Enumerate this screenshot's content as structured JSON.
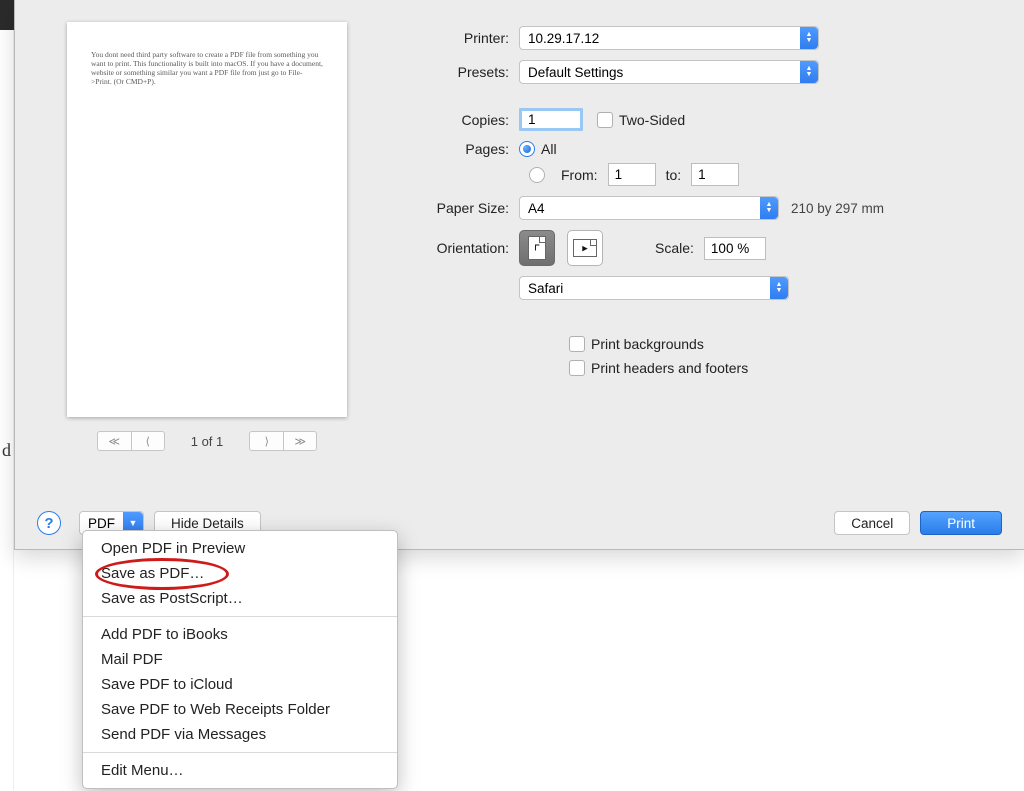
{
  "previewText": "You dont need third party software to create a PDF file from something you want to print. This functionality is built into macOS. If you have a document, website or something similar you want a PDF file from just go to File->Print. (Or CMD+P).",
  "pageNav": {
    "label": "1 of 1"
  },
  "form": {
    "printer": {
      "label": "Printer:",
      "value": "10.29.17.12"
    },
    "presets": {
      "label": "Presets:",
      "value": "Default Settings"
    },
    "copies": {
      "label": "Copies:",
      "value": "1",
      "twoSidedLabel": "Two-Sided"
    },
    "pages": {
      "label": "Pages:",
      "allLabel": "All",
      "fromLabel": "From:",
      "fromValue": "1",
      "toLabel": "to:",
      "toValue": "1"
    },
    "paperSize": {
      "label": "Paper Size:",
      "value": "A4",
      "dims": "210 by 297 mm"
    },
    "orientation": {
      "label": "Orientation:"
    },
    "scale": {
      "label": "Scale:",
      "value": "100 %"
    },
    "app": {
      "value": "Safari"
    },
    "printBackgrounds": "Print backgrounds",
    "printHeadersFooters": "Print headers and footers"
  },
  "footer": {
    "help": "?",
    "pdfLabel": "PDF",
    "hideDetails": "Hide Details",
    "cancel": "Cancel",
    "print": "Print"
  },
  "menu": {
    "openPreview": "Open PDF in Preview",
    "saveAsPdf": "Save as PDF…",
    "saveAsPostscript": "Save as PostScript…",
    "addToIbooks": "Add PDF to iBooks",
    "mailPdf": "Mail PDF",
    "saveToIcloud": "Save PDF to iCloud",
    "saveToWebReceipts": "Save PDF to Web Receipts Folder",
    "sendViaMessages": "Send PDF via Messages",
    "editMenu": "Edit Menu…"
  },
  "bgLetter": "d"
}
